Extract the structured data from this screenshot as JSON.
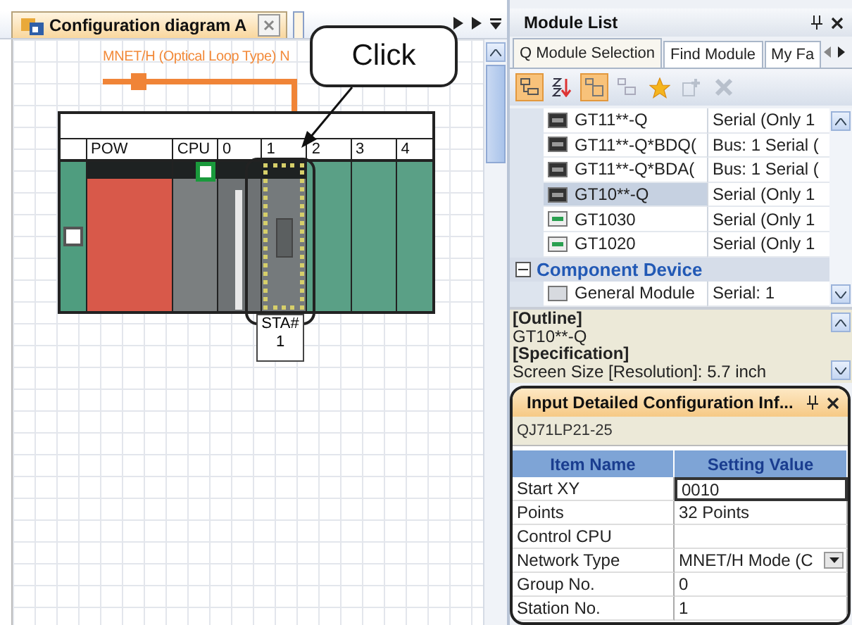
{
  "diagram": {
    "tabs": [
      {
        "label": "Configuration diagram A",
        "selected": true,
        "closable": true
      }
    ],
    "network": {
      "label": "MNET/H (Optical Loop Type) N"
    },
    "rack": {
      "slots": [
        {
          "kind": "blank",
          "selected": false
        },
        {
          "label": "POW",
          "kind": "power",
          "selected": false
        },
        {
          "label": "CPU",
          "kind": "cpu",
          "selected": false
        },
        {
          "label": "0",
          "kind": "io",
          "selected": false
        },
        {
          "label": "1",
          "kind": "network",
          "selected": true
        },
        {
          "label": "2",
          "kind": "empty",
          "selected": false
        },
        {
          "label": "3",
          "kind": "empty",
          "selected": false
        },
        {
          "label": "4",
          "kind": "empty",
          "selected": false
        }
      ]
    },
    "station": {
      "label": "STA#",
      "number": "1"
    }
  },
  "callout": {
    "text": "Click"
  },
  "module_list": {
    "title": "Module List",
    "tabs": [
      {
        "label": "Q Module Selection",
        "selected": true
      },
      {
        "label": "Find Module",
        "selected": false
      },
      {
        "label": "My Fa",
        "selected": false
      }
    ],
    "rows": [
      {
        "kind": "terminal",
        "name": "GT11**-Q",
        "value": "Serial (Only 1",
        "selected": false
      },
      {
        "kind": "terminal",
        "name": "GT11**-Q*BDQ(",
        "value": "Bus: 1 Serial (",
        "selected": false
      },
      {
        "kind": "terminal",
        "name": "GT11**-Q*BDA(",
        "value": "Bus: 1 Serial (",
        "selected": false
      },
      {
        "kind": "terminal",
        "name": "GT10**-Q",
        "value": "Serial (Only 1",
        "selected": true
      },
      {
        "kind": "compact",
        "name": "GT1030",
        "value": "Serial (Only 1",
        "selected": false
      },
      {
        "kind": "compact",
        "name": "GT1020",
        "value": "Serial (Only 1",
        "selected": false
      },
      {
        "kind": "group",
        "name": "Component Device",
        "expanded": true
      },
      {
        "kind": "general",
        "name": "General Module",
        "value": "Serial: 1",
        "selected": false
      }
    ],
    "description": [
      {
        "text": "[Outline]",
        "bold": true
      },
      {
        "text": "GT10**-Q",
        "bold": false
      },
      {
        "text": "[Specification]",
        "bold": true
      },
      {
        "text": "Screen Size [Resolution]: 5.7 inch",
        "bold": false
      }
    ]
  },
  "detail": {
    "title": "Input Detailed Configuration Inf...",
    "model": "QJ71LP21-25",
    "columns": [
      "Item Name",
      "Setting Value"
    ],
    "rows": [
      {
        "name": "Start XY",
        "value": "0010",
        "kind": "input"
      },
      {
        "name": "Points",
        "value": "32 Points",
        "kind": "text"
      },
      {
        "name": "Control CPU",
        "kind": "text"
      },
      {
        "name": "Network Type",
        "value": "MNET/H Mode (C",
        "kind": "dropdown"
      },
      {
        "name": "Group No.",
        "value": "0",
        "kind": "text"
      },
      {
        "name": "Station No.",
        "value": "1",
        "kind": "text"
      }
    ]
  }
}
